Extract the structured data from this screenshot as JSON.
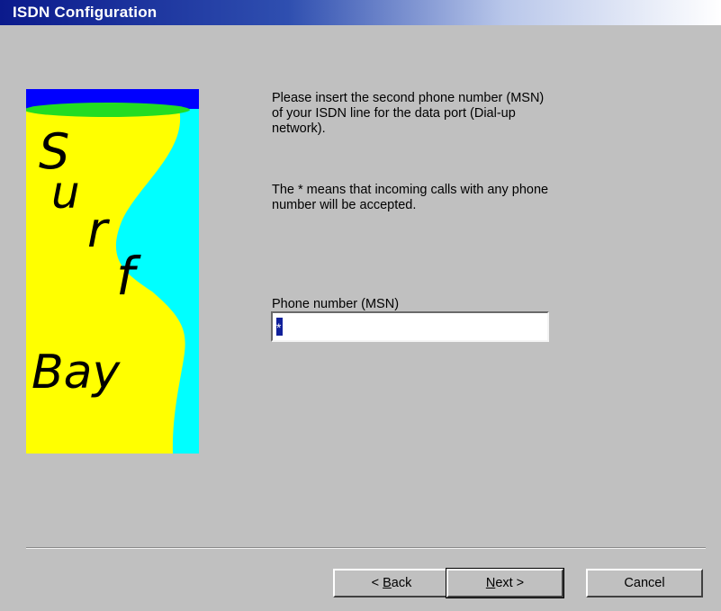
{
  "window": {
    "title": "ISDN Configuration"
  },
  "logo": {
    "line1": "S",
    "line2": "u",
    "line3": "r",
    "line4": "f",
    "line5": "Bay"
  },
  "instructions": {
    "line1": "Please insert the second phone number (MSN)",
    "line2": "of your ISDN line for the data port (Dial-up",
    "line3": "network).",
    "note1": "The * means that incoming calls with any phone",
    "note2": "number will be accepted."
  },
  "phone": {
    "label": "Phone number (MSN)",
    "value": "*"
  },
  "buttons": {
    "back_pre": "< ",
    "back_key": "B",
    "back_post": "ack",
    "next_key": "N",
    "next_post": "ext >",
    "cancel": "Cancel"
  },
  "colors": {
    "logo_yellow": "#ffff00",
    "logo_cyan": "#00ffff",
    "logo_blue": "#0000ff",
    "logo_green": "#22dd22",
    "selection": "#10209a"
  }
}
